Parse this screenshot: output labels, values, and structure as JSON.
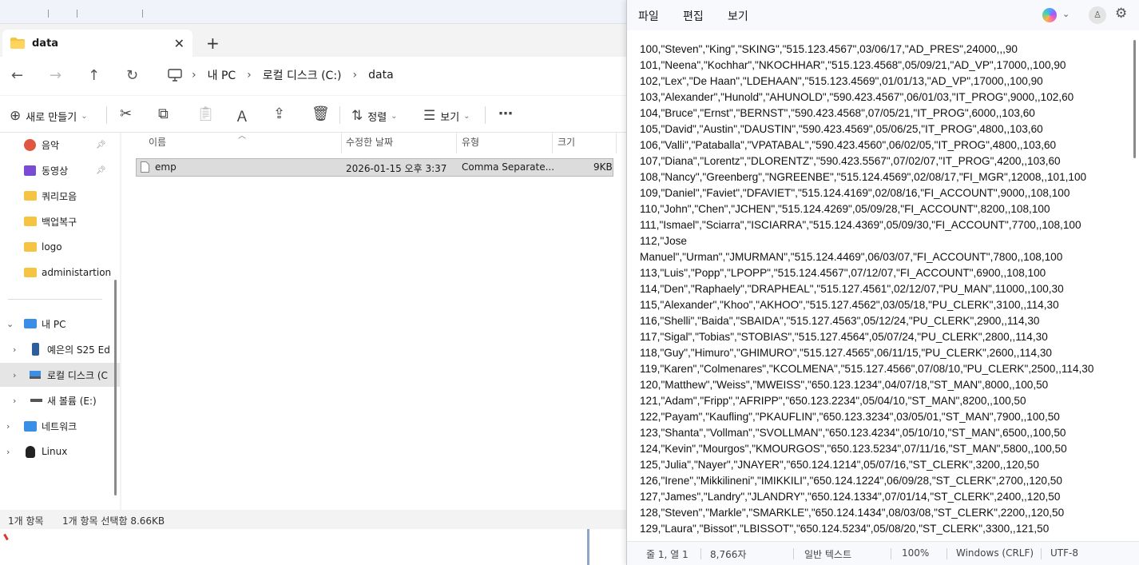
{
  "explorer": {
    "tab_title": "data",
    "breadcrumb": [
      "내 PC",
      "로컬 디스크 (C:)",
      "data"
    ],
    "commands": {
      "new_label": "새로 만들기",
      "sort_label": "정렬",
      "view_label": "보기"
    },
    "nav_items": [
      {
        "label": "음악",
        "icon": "music-icon"
      },
      {
        "label": "동영상",
        "icon": "video-icon"
      },
      {
        "label": "쿼리모음",
        "icon": "folder-icon"
      },
      {
        "label": "백업복구",
        "icon": "folder-icon"
      },
      {
        "label": "logo",
        "icon": "folder-icon"
      },
      {
        "label": "administartion",
        "icon": "folder-icon"
      },
      {
        "label": "내 PC",
        "icon": "pc-icon"
      },
      {
        "label": "예은의 S25 Ed",
        "icon": "phone-icon"
      },
      {
        "label": "로컬 디스크 (C",
        "icon": "drive-icon"
      },
      {
        "label": "새 볼륨 (E:)",
        "icon": "drive-icon"
      },
      {
        "label": "네트워크",
        "icon": "network-icon"
      },
      {
        "label": "Linux",
        "icon": "linux-icon"
      }
    ],
    "columns": [
      "이름",
      "수정한 날짜",
      "유형",
      "크기"
    ],
    "files": [
      {
        "name": "emp",
        "modified": "2026-01-15 오후 3:37",
        "type": "Comma Separate...",
        "size": "9KB"
      }
    ],
    "status": {
      "count": "1개 항목",
      "selected": "1개 항목 선택함 8.66KB"
    }
  },
  "notepad": {
    "menu": [
      "파일",
      "편집",
      "보기"
    ],
    "lines": [
      "100,\"Steven\",\"King\",\"SKING\",\"515.123.4567\",03/06/17,\"AD_PRES\",24000,,,90",
      "101,\"Neena\",\"Kochhar\",\"NKOCHHAR\",\"515.123.4568\",05/09/21,\"AD_VP\",17000,,100,90",
      "102,\"Lex\",\"De Haan\",\"LDEHAAN\",\"515.123.4569\",01/01/13,\"AD_VP\",17000,,100,90",
      "103,\"Alexander\",\"Hunold\",\"AHUNOLD\",\"590.423.4567\",06/01/03,\"IT_PROG\",9000,,102,60",
      "104,\"Bruce\",\"Ernst\",\"BERNST\",\"590.423.4568\",07/05/21,\"IT_PROG\",6000,,103,60",
      "105,\"David\",\"Austin\",\"DAUSTIN\",\"590.423.4569\",05/06/25,\"IT_PROG\",4800,,103,60",
      "106,\"Valli\",\"Pataballa\",\"VPATABAL\",\"590.423.4560\",06/02/05,\"IT_PROG\",4800,,103,60",
      "107,\"Diana\",\"Lorentz\",\"DLORENTZ\",\"590.423.5567\",07/02/07,\"IT_PROG\",4200,,103,60",
      "108,\"Nancy\",\"Greenberg\",\"NGREENBE\",\"515.124.4569\",02/08/17,\"FI_MGR\",12008,,101,100",
      "109,\"Daniel\",\"Faviet\",\"DFAVIET\",\"515.124.4169\",02/08/16,\"FI_ACCOUNT\",9000,,108,100",
      "110,\"John\",\"Chen\",\"JCHEN\",\"515.124.4269\",05/09/28,\"FI_ACCOUNT\",8200,,108,100",
      "111,\"Ismael\",\"Sciarra\",\"ISCIARRA\",\"515.124.4369\",05/09/30,\"FI_ACCOUNT\",7700,,108,100",
      "112,\"Jose",
      "Manuel\",\"Urman\",\"JMURMAN\",\"515.124.4469\",06/03/07,\"FI_ACCOUNT\",7800,,108,100",
      "113,\"Luis\",\"Popp\",\"LPOPP\",\"515.124.4567\",07/12/07,\"FI_ACCOUNT\",6900,,108,100",
      "114,\"Den\",\"Raphaely\",\"DRAPHEAL\",\"515.127.4561\",02/12/07,\"PU_MAN\",11000,,100,30",
      "115,\"Alexander\",\"Khoo\",\"AKHOO\",\"515.127.4562\",03/05/18,\"PU_CLERK\",3100,,114,30",
      "116,\"Shelli\",\"Baida\",\"SBAIDA\",\"515.127.4563\",05/12/24,\"PU_CLERK\",2900,,114,30",
      "117,\"Sigal\",\"Tobias\",\"STOBIAS\",\"515.127.4564\",05/07/24,\"PU_CLERK\",2800,,114,30",
      "118,\"Guy\",\"Himuro\",\"GHIMURO\",\"515.127.4565\",06/11/15,\"PU_CLERK\",2600,,114,30",
      "119,\"Karen\",\"Colmenares\",\"KCOLMENA\",\"515.127.4566\",07/08/10,\"PU_CLERK\",2500,,114,30",
      "120,\"Matthew\",\"Weiss\",\"MWEISS\",\"650.123.1234\",04/07/18,\"ST_MAN\",8000,,100,50",
      "121,\"Adam\",\"Fripp\",\"AFRIPP\",\"650.123.2234\",05/04/10,\"ST_MAN\",8200,,100,50",
      "122,\"Payam\",\"Kaufling\",\"PKAUFLIN\",\"650.123.3234\",03/05/01,\"ST_MAN\",7900,,100,50",
      "123,\"Shanta\",\"Vollman\",\"SVOLLMAN\",\"650.123.4234\",05/10/10,\"ST_MAN\",6500,,100,50",
      "124,\"Kevin\",\"Mourgos\",\"KMOURGOS\",\"650.123.5234\",07/11/16,\"ST_MAN\",5800,,100,50",
      "125,\"Julia\",\"Nayer\",\"JNAYER\",\"650.124.1214\",05/07/16,\"ST_CLERK\",3200,,120,50",
      "126,\"Irene\",\"Mikkilineni\",\"IMIKKILI\",\"650.124.1224\",06/09/28,\"ST_CLERK\",2700,,120,50",
      "127,\"James\",\"Landry\",\"JLANDRY\",\"650.124.1334\",07/01/14,\"ST_CLERK\",2400,,120,50",
      "128,\"Steven\",\"Markle\",\"SMARKLE\",\"650.124.1434\",08/03/08,\"ST_CLERK\",2200,,120,50",
      "129,\"Laura\",\"Bissot\",\"LBISSOT\",\"650.124.5234\",05/08/20,\"ST_CLERK\",3300,,121,50"
    ],
    "status": {
      "position": "줄 1, 열 1",
      "chars": "8,766자",
      "format": "일반 텍스트",
      "zoom": "100%",
      "line_ending": "Windows (CRLF)",
      "encoding": "UTF-8"
    }
  }
}
